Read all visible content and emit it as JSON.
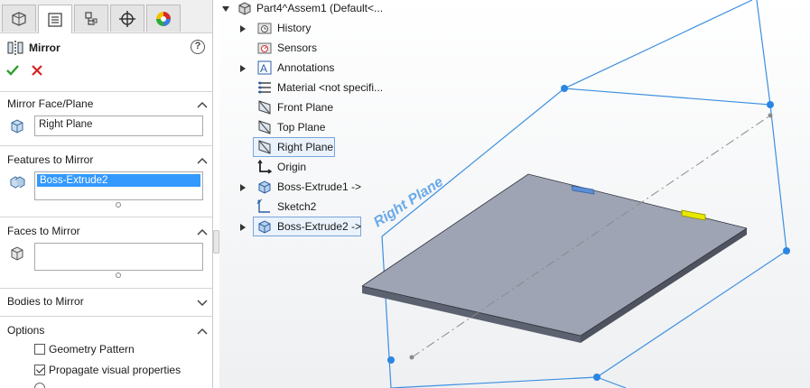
{
  "property_manager": {
    "tabs": [
      "feature-manager-tab",
      "property-manager-tab",
      "configuration-manager-tab",
      "dimxpert-tab",
      "display-manager-tab"
    ],
    "title": "Mirror",
    "help_label": "?",
    "groups": {
      "mirror_face_plane": {
        "label": "Mirror Face/Plane",
        "value": "Right Plane"
      },
      "features_to_mirror": {
        "label": "Features to Mirror",
        "items": [
          "Boss-Extrude2"
        ]
      },
      "faces_to_mirror": {
        "label": "Faces to Mirror",
        "value": ""
      },
      "bodies_to_mirror": {
        "label": "Bodies to Mirror"
      },
      "options": {
        "label": "Options",
        "geometry_pattern": {
          "label": "Geometry Pattern",
          "checked": false
        },
        "propagate_visual": {
          "label": "Propagate visual properties",
          "checked": true
        }
      }
    }
  },
  "feature_tree": {
    "root": "Part4^Assem1  (Default<...",
    "items": [
      {
        "label": "History",
        "expandable": true,
        "icon": "history-folder-icon"
      },
      {
        "label": "Sensors",
        "expandable": false,
        "icon": "sensors-folder-icon"
      },
      {
        "label": "Annotations",
        "expandable": true,
        "icon": "annotations-icon"
      },
      {
        "label": "Material <not specifi...",
        "expandable": false,
        "icon": "material-icon"
      },
      {
        "label": "Front Plane",
        "expandable": false,
        "icon": "plane-icon"
      },
      {
        "label": "Top Plane",
        "expandable": false,
        "icon": "plane-icon"
      },
      {
        "label": "Right Plane",
        "expandable": false,
        "icon": "plane-icon",
        "selected": true
      },
      {
        "label": "Origin",
        "expandable": false,
        "icon": "origin-icon"
      },
      {
        "label": "Boss-Extrude1 ->",
        "expandable": true,
        "icon": "extrude-icon"
      },
      {
        "label": "Sketch2",
        "expandable": false,
        "icon": "sketch-icon"
      },
      {
        "label": "Boss-Extrude2 ->",
        "expandable": true,
        "icon": "extrude-icon",
        "selected": true
      }
    ]
  },
  "viewport": {
    "plane_label": "Right Plane",
    "colors": {
      "plane_edge": "#3d8fe0",
      "plate_top": "#9ea4b4",
      "plate_side": "#5d6270",
      "highlight": "#e8e800"
    }
  }
}
